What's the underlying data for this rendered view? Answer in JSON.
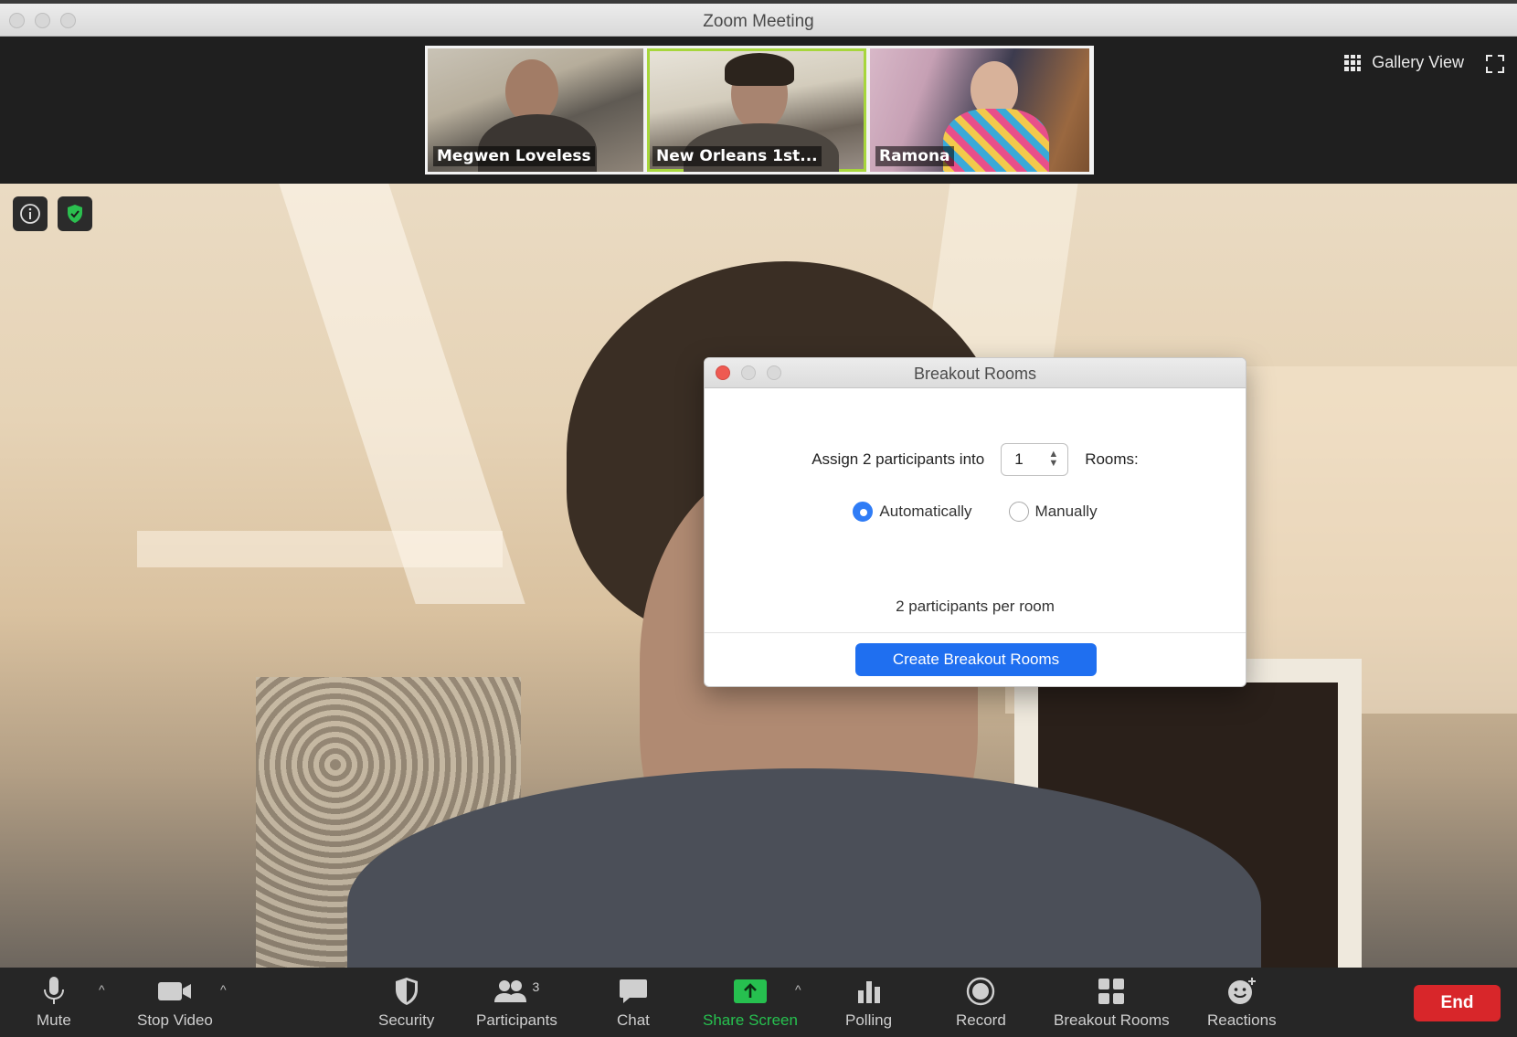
{
  "window": {
    "title": "Zoom Meeting"
  },
  "participants_strip": [
    {
      "name": "Megwen Loveless",
      "active": false
    },
    {
      "name": "New Orleans 1st...",
      "active": true
    },
    {
      "name": "Ramona",
      "active": false
    }
  ],
  "view": {
    "gallery_label": "Gallery View"
  },
  "overlay": {
    "info_icon": "info-icon",
    "security_icon": "shield-check-icon"
  },
  "dialog": {
    "title": "Breakout Rooms",
    "assign_prefix": "Assign 2 participants into",
    "rooms_value": "1",
    "rooms_suffix": "Rooms:",
    "option_auto": "Automatically",
    "option_manual": "Manually",
    "selected_option": "Automatically",
    "per_room_text": "2 participants per room",
    "create_button": "Create Breakout Rooms"
  },
  "toolbar": {
    "mute": "Mute",
    "stop_video": "Stop Video",
    "security": "Security",
    "participants": "Participants",
    "participants_count": "3",
    "chat": "Chat",
    "share_screen": "Share Screen",
    "polling": "Polling",
    "record": "Record",
    "breakout_rooms": "Breakout Rooms",
    "reactions": "Reactions",
    "end": "End"
  },
  "colors": {
    "accent_blue": "#1f6ff0",
    "share_green": "#26c04f",
    "end_red": "#d8262a",
    "active_border": "#a7d63c"
  }
}
